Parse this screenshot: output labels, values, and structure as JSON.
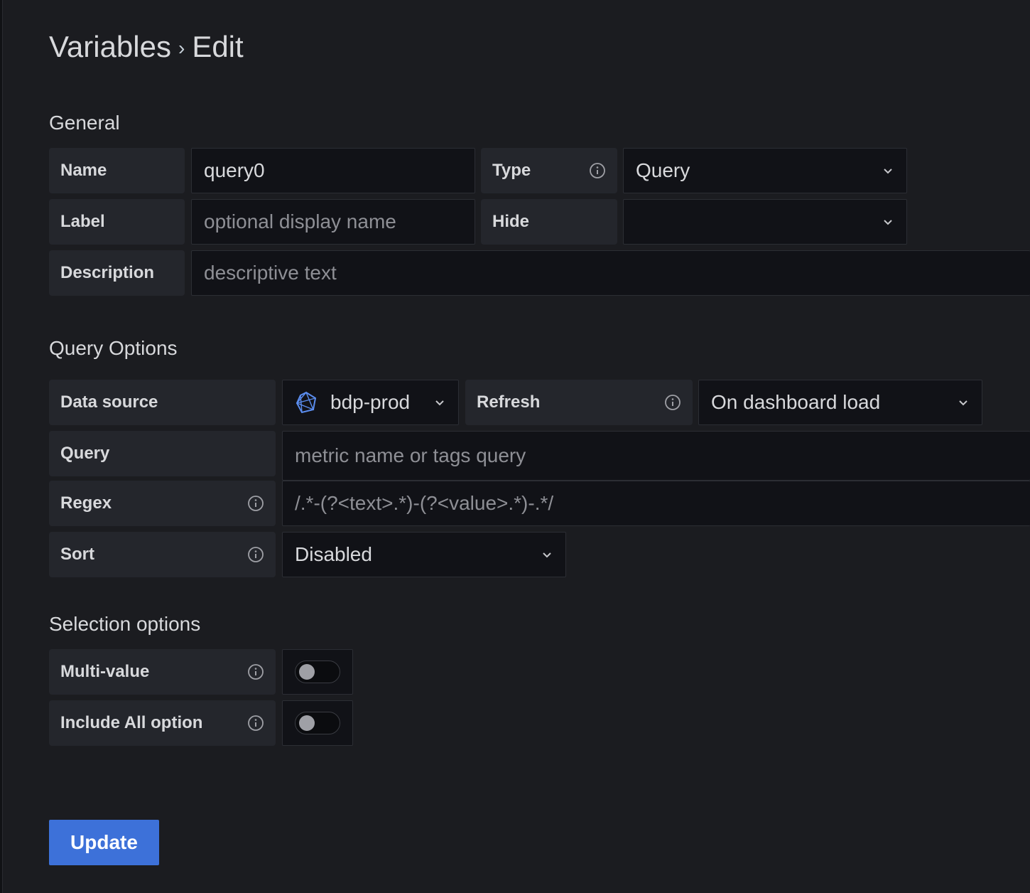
{
  "header": {
    "breadcrumb_root": "Variables",
    "separator": "›",
    "current": "Edit"
  },
  "general": {
    "title": "General",
    "name_label": "Name",
    "name_value": "query0",
    "type_label": "Type",
    "type_value": "Query",
    "label_label": "Label",
    "label_placeholder": "optional display name",
    "hide_label": "Hide",
    "hide_value": "",
    "description_label": "Description",
    "description_placeholder": "descriptive text"
  },
  "query_options": {
    "title": "Query Options",
    "datasource_label": "Data source",
    "datasource_value": "bdp-prod",
    "datasource_icon": "datasource-icon",
    "refresh_label": "Refresh",
    "refresh_value": "On dashboard load",
    "query_label": "Query",
    "query_placeholder": "metric name or tags query",
    "regex_label": "Regex",
    "regex_placeholder": "/.*-(?<text>.*)-(?<value>.*)-.*/",
    "sort_label": "Sort",
    "sort_value": "Disabled"
  },
  "selection_options": {
    "title": "Selection options",
    "multi_value_label": "Multi-value",
    "multi_value_enabled": false,
    "include_all_label": "Include All option",
    "include_all_enabled": false
  },
  "actions": {
    "update_label": "Update"
  },
  "colors": {
    "background": "#1b1c20",
    "label_bg": "#24262c",
    "input_bg": "#111217",
    "primary": "#3d71d9",
    "datasource_icon": "#5b8def"
  }
}
